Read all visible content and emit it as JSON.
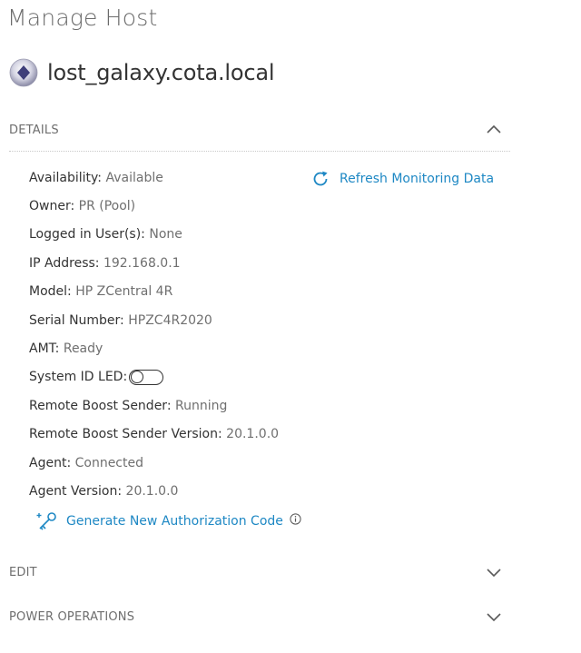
{
  "page": {
    "title": "Manage Host"
  },
  "host": {
    "name": "lost_galaxy.cota.local",
    "icon": "host-status-icon"
  },
  "sections": {
    "details": {
      "label": "DETAILS",
      "expanded": true,
      "refresh_label": "Refresh Monitoring Data",
      "fields": {
        "availability": {
          "label": "Availability:",
          "value": "Available"
        },
        "owner": {
          "label": "Owner:",
          "value": "PR (Pool)"
        },
        "logged_in": {
          "label": "Logged in User(s):",
          "value": "None"
        },
        "ip": {
          "label": "IP Address:",
          "value": "192.168.0.1"
        },
        "model": {
          "label": "Model:",
          "value": "HP ZCentral 4R"
        },
        "serial": {
          "label": "Serial Number:",
          "value": "HPZC4R2020"
        },
        "amt": {
          "label": "AMT:",
          "value": "Ready"
        },
        "system_id_led": {
          "label": "System ID LED:",
          "on": false
        },
        "rb_sender": {
          "label": "Remote Boost Sender:",
          "value": "Running"
        },
        "rb_sender_version": {
          "label": "Remote Boost Sender Version:",
          "value": "20.1.0.0"
        },
        "agent": {
          "label": "Agent:",
          "value": "Connected"
        },
        "agent_version": {
          "label": "Agent Version:",
          "value": "20.1.0.0"
        }
      },
      "generate_code_label": "Generate New Authorization Code"
    },
    "edit": {
      "label": "EDIT",
      "expanded": false
    },
    "power_operations": {
      "label": "POWER OPERATIONS",
      "expanded": false
    }
  },
  "colors": {
    "link": "#1e88c4",
    "title": "#6b6b6b",
    "value": "#6f6f6f",
    "host_icon_primary": "#3f3f7a"
  }
}
